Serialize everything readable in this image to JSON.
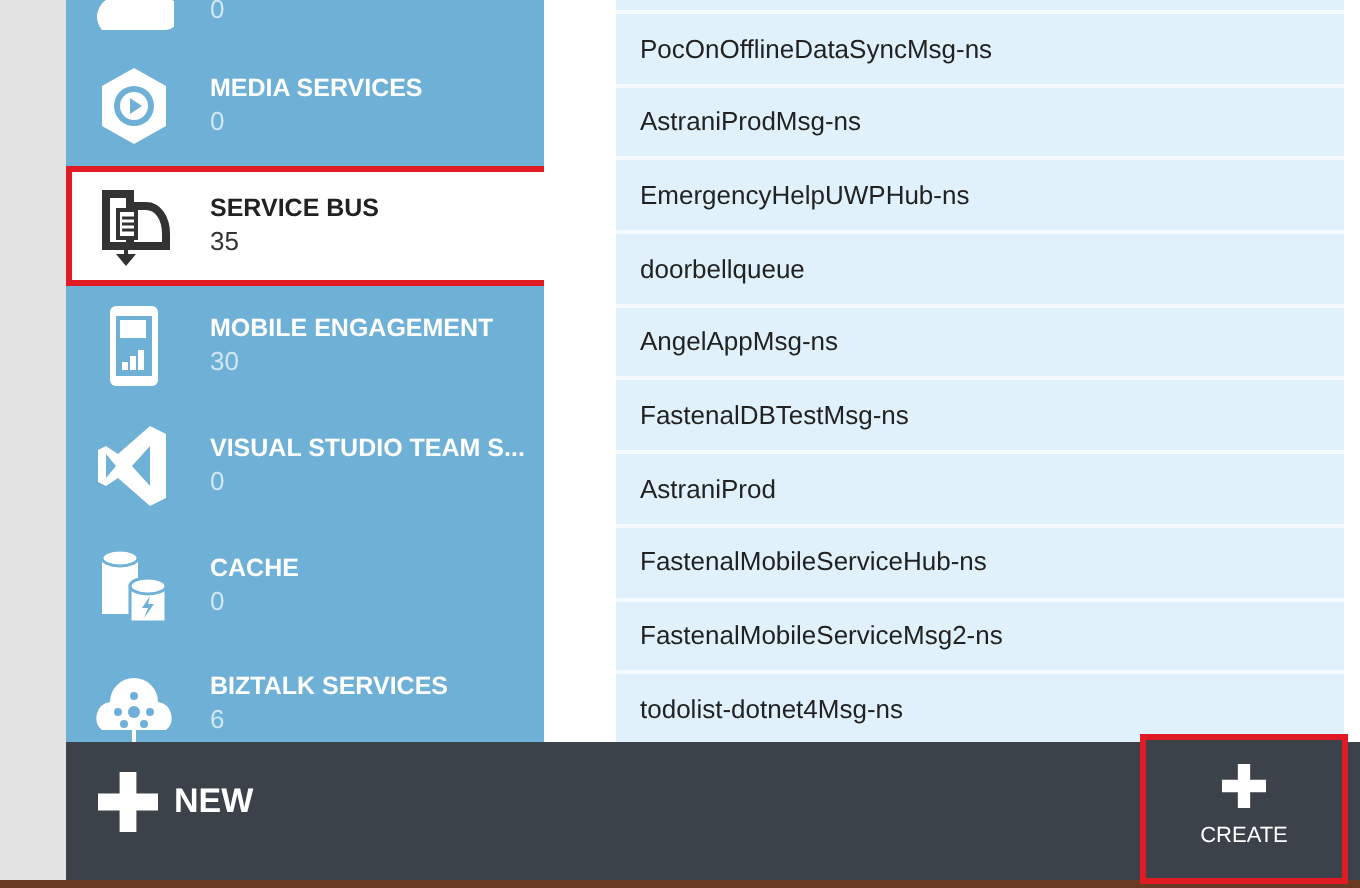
{
  "sidebar": {
    "items": [
      {
        "kind": "cloud",
        "count": "0",
        "selected": false,
        "highlighted": false
      },
      {
        "kind": "media",
        "title": "MEDIA SERVICES",
        "count": "0",
        "selected": false,
        "highlighted": false
      },
      {
        "kind": "servicebus",
        "title": "SERVICE BUS",
        "count": "35",
        "selected": true,
        "highlighted": true
      },
      {
        "kind": "mobile",
        "title": "MOBILE ENGAGEMENT",
        "count": "30",
        "selected": false,
        "highlighted": false
      },
      {
        "kind": "vs",
        "title": "VISUAL STUDIO TEAM S...",
        "count": "0",
        "selected": false,
        "highlighted": false
      },
      {
        "kind": "cache",
        "title": "CACHE",
        "count": "0",
        "selected": false,
        "highlighted": false
      },
      {
        "kind": "biztalk",
        "title": "BIZTALK SERVICES",
        "count": "6",
        "selected": false,
        "highlighted": false
      }
    ]
  },
  "namespaces": [
    "PocOnOfflineDataSyncMsg-ns",
    "AstraniProdMsg-ns",
    "EmergencyHelpUWPHub-ns",
    "doorbellqueue",
    "AngelAppMsg-ns",
    "FastenalDBTestMsg-ns",
    "AstraniProd",
    "FastenalMobileServiceHub-ns",
    "FastenalMobileServiceMsg2-ns",
    "todolist-dotnet4Msg-ns"
  ],
  "command_bar": {
    "new_label": "NEW",
    "create": {
      "label": "CREATE",
      "highlighted": true
    }
  }
}
